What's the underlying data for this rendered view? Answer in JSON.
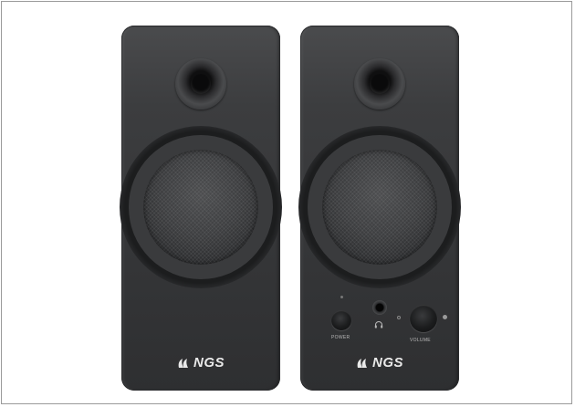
{
  "brand": "NGS",
  "controls": {
    "power_label": "POWER",
    "volume_label": "VOLUME"
  },
  "icons": [
    "ngs-logo-icon",
    "headphone-icon",
    "power-knob",
    "volume-knob"
  ],
  "colors": {
    "background": "#ffffff",
    "speaker_body": "#3a3b3d",
    "logo_text": "#e9e9e9"
  }
}
